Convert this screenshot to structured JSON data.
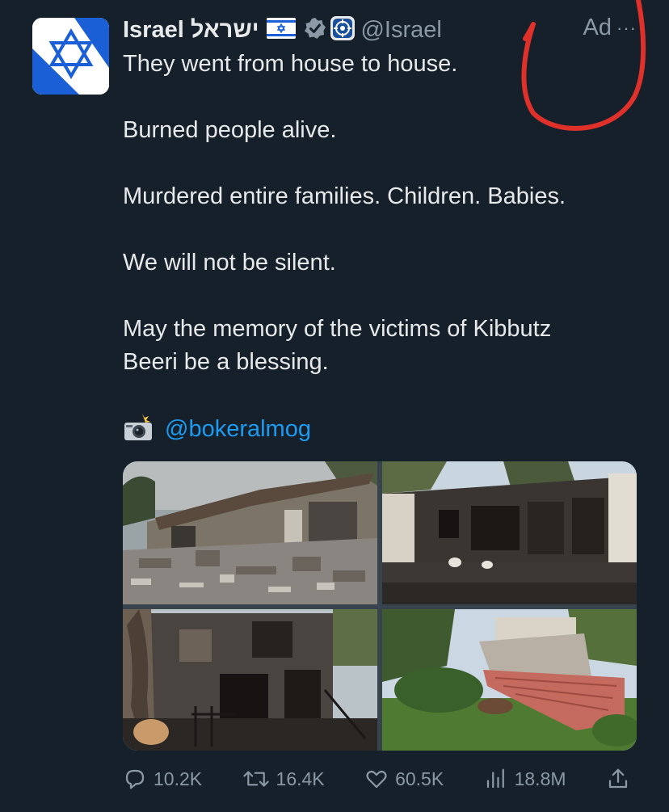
{
  "author": {
    "display_name": "Israel",
    "hebrew_name": "ישראל",
    "handle": "@Israel",
    "flag": "🇮🇱"
  },
  "ad_label": "Ad",
  "more_label": "···",
  "tweet": {
    "lines": [
      "They went from house to house.",
      "Burned people alive.",
      "Murdered entire families. Children. Babies.",
      "We will not be silent.",
      "May the memory of the victims of Kibbutz",
      "Beeri be a blessing."
    ],
    "credit_mention": "@bokeralmog"
  },
  "actions": {
    "replies": "10.2K",
    "reposts": "16.4K",
    "likes": "60.5K",
    "views": "18.8M"
  },
  "colors": {
    "background": "#15202b",
    "text": "#e7e9ea",
    "muted": "#8b98a5",
    "link": "#1d9bf0",
    "annotation": "#e0302a",
    "flag_blue": "#1a5fd6"
  },
  "icons": {
    "avatar": "star-of-david-icon",
    "verified": "verified-check-icon",
    "gov": "government-affiliation-icon",
    "camera": "camera-flash-icon",
    "reply": "speech-bubble-icon",
    "repost": "repost-arrows-icon",
    "like": "heart-icon",
    "views": "bar-chart-icon",
    "share": "share-upload-icon"
  }
}
